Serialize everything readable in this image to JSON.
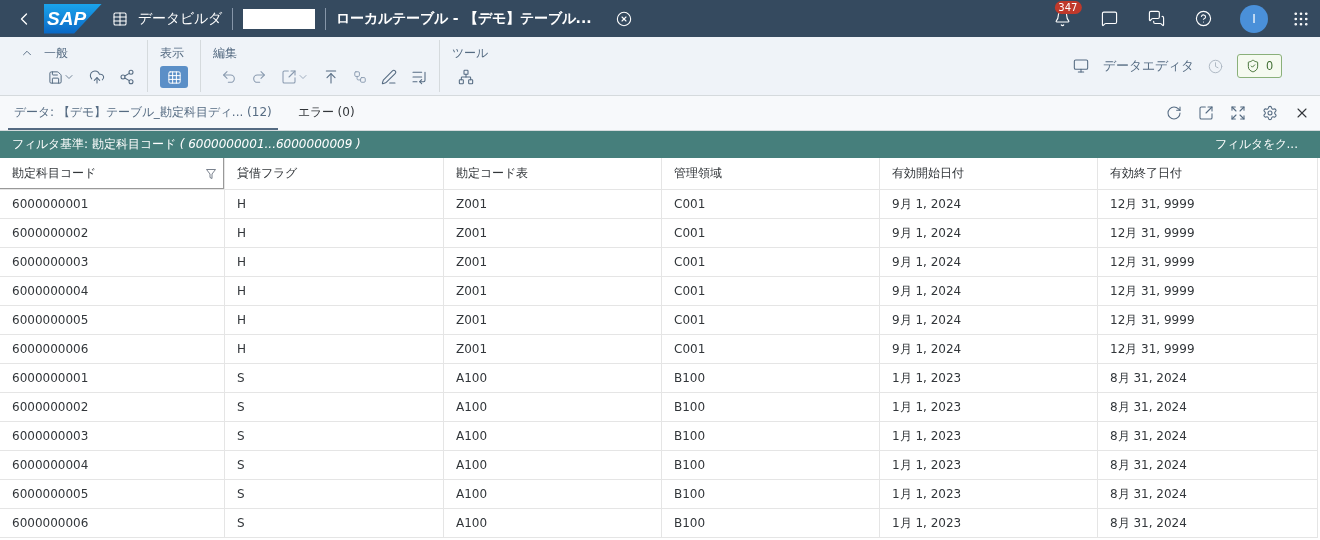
{
  "shell": {
    "logo": "SAP",
    "app_title": "データビルダ",
    "document_title": "ローカルテーブル - 【デモ】テーブル...",
    "notification_count": "347",
    "avatar": "I"
  },
  "toolbar": {
    "groups": [
      {
        "label": "一般",
        "collapse": true
      },
      {
        "label": "表示"
      },
      {
        "label": "編集"
      },
      {
        "label": "ツール"
      }
    ],
    "view_grid_selected": true,
    "editor_label": "データエディタ",
    "validation_count": "0"
  },
  "tabs": [
    {
      "label": "データ: 【デモ】テーブル_勘定科目ディ... (12)",
      "selected": true
    },
    {
      "label": "エラー (0)",
      "selected": false
    }
  ],
  "filter_bar": {
    "text": "フィルタ基準: 勘定科目コード *( 6000000001...6000000009 )*",
    "clear": "フィルタをク..."
  },
  "table": {
    "columns": [
      {
        "label": "勘定科目コード",
        "filtered": true
      },
      {
        "label": "貸借フラグ",
        "filtered": false
      },
      {
        "label": "勘定コード表",
        "filtered": false
      },
      {
        "label": "管理領域",
        "filtered": false
      },
      {
        "label": "有効開始日付",
        "filtered": false
      },
      {
        "label": "有効終了日付",
        "filtered": false
      }
    ],
    "rows": [
      [
        "6000000001",
        "H",
        "Z001",
        "C001",
        "9月 1, 2024",
        "12月 31, 9999"
      ],
      [
        "6000000002",
        "H",
        "Z001",
        "C001",
        "9月 1, 2024",
        "12月 31, 9999"
      ],
      [
        "6000000003",
        "H",
        "Z001",
        "C001",
        "9月 1, 2024",
        "12月 31, 9999"
      ],
      [
        "6000000004",
        "H",
        "Z001",
        "C001",
        "9月 1, 2024",
        "12月 31, 9999"
      ],
      [
        "6000000005",
        "H",
        "Z001",
        "C001",
        "9月 1, 2024",
        "12月 31, 9999"
      ],
      [
        "6000000006",
        "H",
        "Z001",
        "C001",
        "9月 1, 2024",
        "12月 31, 9999"
      ],
      [
        "6000000001",
        "S",
        "A100",
        "B100",
        "1月 1, 2023",
        "8月 31, 2024"
      ],
      [
        "6000000002",
        "S",
        "A100",
        "B100",
        "1月 1, 2023",
        "8月 31, 2024"
      ],
      [
        "6000000003",
        "S",
        "A100",
        "B100",
        "1月 1, 2023",
        "8月 31, 2024"
      ],
      [
        "6000000004",
        "S",
        "A100",
        "B100",
        "1月 1, 2023",
        "8月 31, 2024"
      ],
      [
        "6000000005",
        "S",
        "A100",
        "B100",
        "1月 1, 2023",
        "8月 31, 2024"
      ],
      [
        "6000000006",
        "S",
        "A100",
        "B100",
        "1月 1, 2023",
        "8月 31, 2024"
      ]
    ]
  }
}
